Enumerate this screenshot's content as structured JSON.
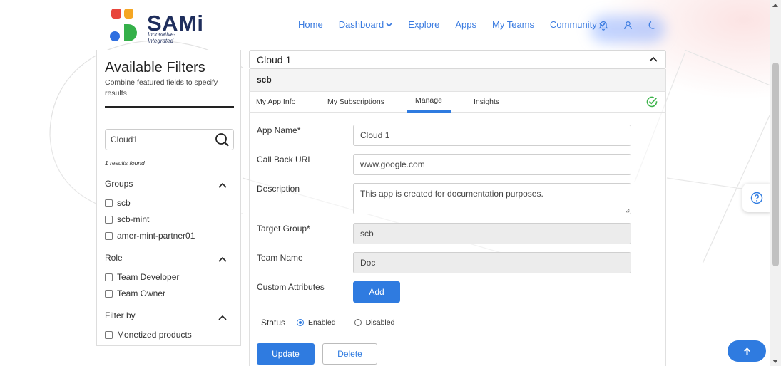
{
  "brand": {
    "name": "SAMi",
    "tagline": "Innovative-Integrated"
  },
  "nav": {
    "items": [
      {
        "label": "Home",
        "dropdown": false
      },
      {
        "label": "Dashboard",
        "dropdown": true
      },
      {
        "label": "Explore",
        "dropdown": false
      },
      {
        "label": "Apps",
        "dropdown": false
      },
      {
        "label": "My Teams",
        "dropdown": false
      },
      {
        "label": "Community",
        "dropdown": true
      }
    ],
    "icons": [
      "bell-icon",
      "user-icon",
      "moon-icon"
    ]
  },
  "filters": {
    "title": "Available Filters",
    "subtitle": "Combine featured fields to specify results",
    "search_value": "Cloud1",
    "results": "1 results found",
    "groups_label": "Groups",
    "groups": [
      "scb",
      "scb-mint",
      "amer-mint-partner01"
    ],
    "role_label": "Role",
    "roles": [
      "Team Developer",
      "Team Owner"
    ],
    "filterby_label": "Filter by",
    "filterby": [
      "Monetized products"
    ]
  },
  "card": {
    "title": "Cloud 1",
    "group_heading": "scb",
    "tabs": [
      "My App Info",
      "My Subscriptions",
      "Manage",
      "Insights"
    ],
    "active_tab": "Manage"
  },
  "form": {
    "app_name_label": "App Name*",
    "app_name": "Cloud 1",
    "callback_label": "Call Back URL",
    "callback": "www.google.com",
    "description_label": "Description",
    "description": "This app is created for documentation purposes.",
    "target_group_label": "Target Group*",
    "target_group": "scb",
    "team_name_label": "Team Name",
    "team_name": "Doc",
    "custom_attr_label": "Custom Attributes",
    "add_label": "Add",
    "status_label": "Status",
    "enabled_label": "Enabled",
    "disabled_label": "Disabled",
    "status_value": "Enabled",
    "update_label": "Update",
    "delete_label": "Delete"
  },
  "colors": {
    "accent": "#2f7be0",
    "nav_link": "#3a7be0",
    "brand_dark": "#1f2e5c",
    "success": "#3cb34a"
  }
}
